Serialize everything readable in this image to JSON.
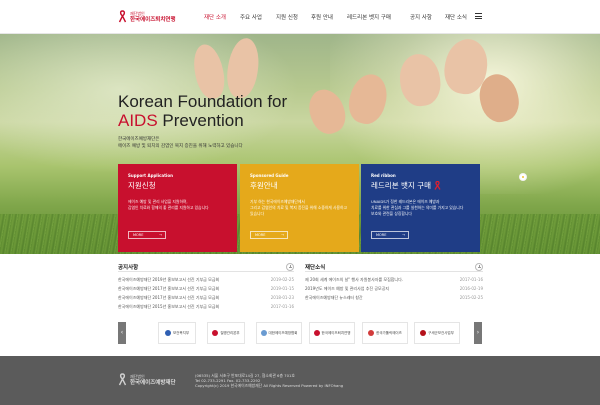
{
  "header": {
    "logo_small": "재단법인",
    "logo_name": "한국에이즈퇴치연맹",
    "nav": [
      "재단 소개",
      "주요 사업",
      "지원 신청",
      "후원 안내",
      "레드리본 벳지 구매",
      "공지 사항",
      "재단 소식"
    ],
    "active_index": 0
  },
  "hero": {
    "title_line1": "Korean Foundation for",
    "title_aids": "AIDS",
    "title_rest": " Prevention",
    "desc_line1": "한국에이즈예방재단은",
    "desc_line2": "에이즈 예방 및 퇴치의 감염인 복지 증진을 위해 노력하고 있습니다"
  },
  "cards": [
    {
      "sub": "Support Application",
      "title": "지원신청",
      "desc1": "에이즈 예방 및 관리 사업을 지원하며,",
      "desc2": "감염인 치료와 함께의 좋 관리를 지원하고 있습니다",
      "more": "MORE",
      "color": "#c8102e"
    },
    {
      "sub": "Sponsored Guide",
      "title": "후원안내",
      "desc1": "기부 하는 한국에이즈예방재단에서",
      "desc2": "그리고 감염인의 치료 및 복지 증진을 위해 소중하게 사용하고 있습니다",
      "more": "MORE",
      "color": "#e5a91b"
    },
    {
      "sub": "Red ribbon",
      "title": "레드리본 뱃지 구매",
      "desc1": "UNAIDS가 정한 레드리본은 에이즈 예방과",
      "desc2": "치료를 위한 관심과 그를 실천하는 의미를 가지고 있습니다",
      "desc3": "보호와 관련을 상징합니다",
      "more": "MORE",
      "color": "#1f3d86"
    }
  ],
  "notice": {
    "title": "공지사항",
    "items": [
      {
        "text": "한국에이즈예방재단 2019년 홍보보고서 선진 기부금 모금회",
        "date": "2019-02-25"
      },
      {
        "text": "한국에이즈예방재단 2017년 홍보보고서 선진 기부금 모금회",
        "date": "2019-01-15"
      },
      {
        "text": "한국에이즈예방재단 2017년 홍보보고서 선진 기부금 모금회",
        "date": "2018-01-23"
      },
      {
        "text": "한국에이즈예방재단 2015년 홍보보고서 선진 기부금 모금회",
        "date": "2017-01-16"
      }
    ]
  },
  "news": {
    "title": "재단소식",
    "items": [
      {
        "text": "제 20회 세계 에이즈의 날\" 행사 자원봉사자를 모집합니다.",
        "date": "2017-01-16"
      },
      {
        "text": "2019년도 에이즈 예방 및 관리사업 추진 공모공지",
        "date": "2016-02-19"
      },
      {
        "text": "한국에이즈예방재단 뉴스레터 창간",
        "date": "2015-02-25"
      }
    ]
  },
  "partners": [
    {
      "name": "보건복지부",
      "color": "#2f5fb3"
    },
    {
      "name": "질병관리본부",
      "color": "#c8102e"
    },
    {
      "name": "대한에이즈예방협회",
      "color": "#6a9bd1"
    },
    {
      "name": "한국에이즈퇴치연맹",
      "color": "#c8102e"
    },
    {
      "name": "한국가톨릭에이즈",
      "color": "#d23c3c"
    },
    {
      "name": "구세군보건사업부",
      "color": "#b5121b"
    }
  ],
  "footer": {
    "logo_small": "재단법인",
    "logo_name": "한국에이즈예방재단",
    "address": "(06535) 서울 서초구 반포대로14길 27, 협소회관 6층 701호",
    "tel": "Tel 02-733-2291  Fax. 02-733-2292",
    "copyright": "Copyright(c) 2019 한국에이즈예방재단 All Rights Reserved Powered by INFOhang"
  }
}
